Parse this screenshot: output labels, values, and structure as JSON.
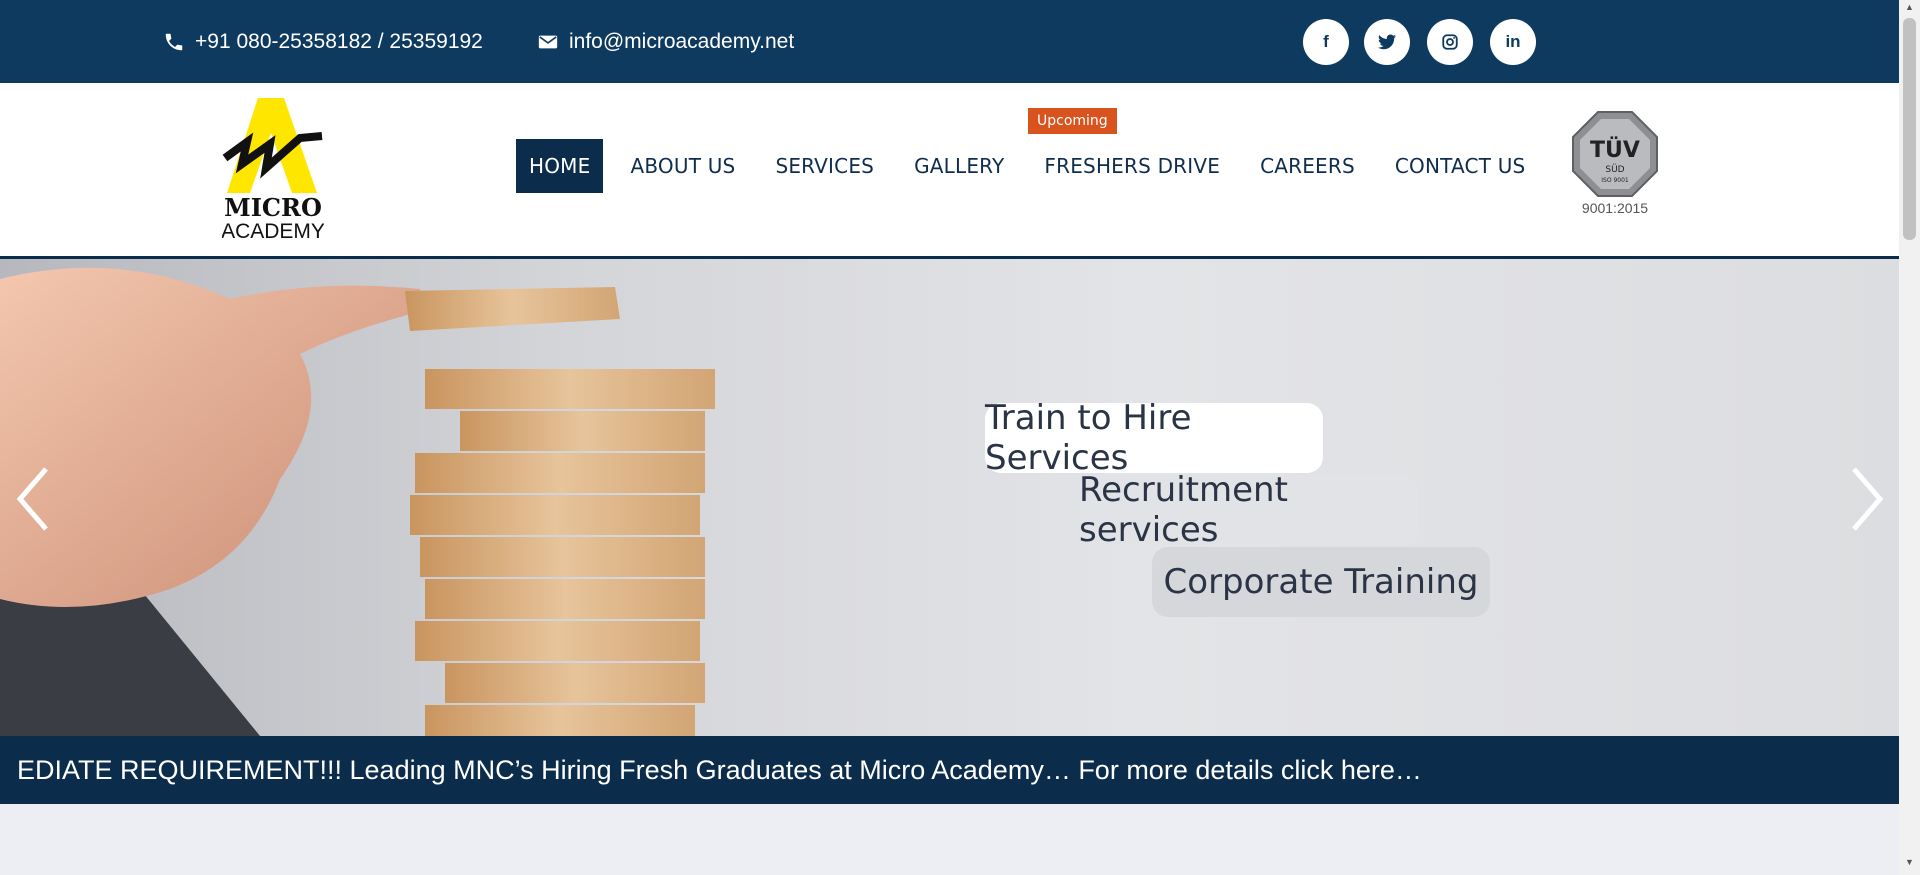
{
  "topbar": {
    "phone": "+91 080-25358182 / 25359192",
    "email": "info@microacademy.net",
    "social": [
      {
        "name": "facebook",
        "glyph": "f"
      },
      {
        "name": "twitter",
        "glyph": "t"
      },
      {
        "name": "instagram",
        "glyph": "◎"
      },
      {
        "name": "linkedin",
        "glyph": "in"
      }
    ]
  },
  "brand": {
    "logo_line1": "MICRO",
    "logo_line2": "ACADEMY",
    "logo_color": "#ffe600"
  },
  "nav": {
    "items": [
      "HOME",
      "ABOUT US",
      "SERVICES",
      "GALLERY",
      "FRESHERS DRIVE",
      "CAREERS",
      "CONTACT US"
    ],
    "active": "HOME",
    "badge": "Upcoming"
  },
  "certification": {
    "mark": "TÜV",
    "sub": "SÜD",
    "iso": "ISO 9001",
    "standard": "9001:2015"
  },
  "hero": {
    "services": [
      "Train to Hire Services",
      "Recruitment services",
      "Corporate Training"
    ]
  },
  "ticker": {
    "text": "EDIATE REQUIREMENT!!! Leading MNC’s Hiring Fresh Graduates at Micro Academy… For more details click here…"
  },
  "colors": {
    "primary": "#0d3a5e",
    "nav_dark": "#0b2c4a",
    "badge": "#d9531e"
  }
}
